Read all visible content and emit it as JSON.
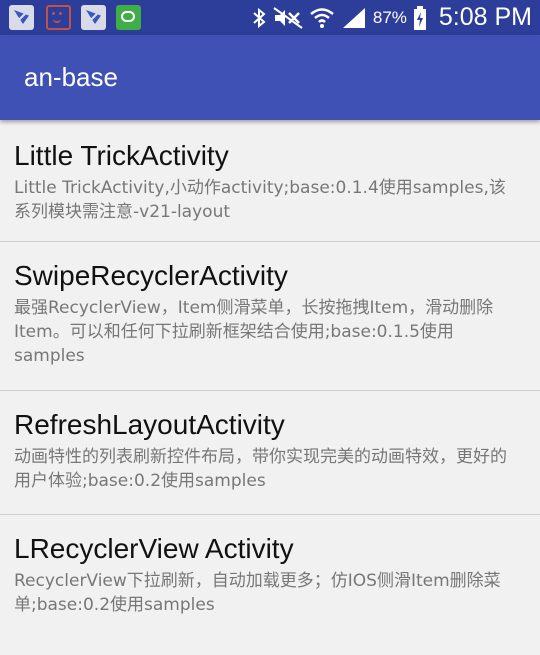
{
  "status_bar": {
    "notification_icons": [
      "app-bird-icon",
      "smiley-icon",
      "app-bird-icon",
      "chat-app-icon"
    ],
    "system_icons": [
      "bluetooth-icon",
      "mute-icon",
      "wifi-icon",
      "signal-icon",
      "battery-charging-icon"
    ],
    "battery": "87%",
    "time": "5:08 PM",
    "background_color": "#2c3e9a"
  },
  "app_bar": {
    "title": "an-base",
    "background_color": "#3f51b5"
  },
  "list": {
    "items": [
      {
        "title": "Little TrickActivity",
        "description": "Little TrickActivity,小动作activity;base:0.1.4使用samples,该系列模块需注意-v21-layout"
      },
      {
        "title": "SwipeRecyclerActivity",
        "description": "最强RecyclerView，Item侧滑菜单，长按拖拽Item，滑动删除Item。可以和任何下拉刷新框架结合使用;base:0.1.5使用samples"
      },
      {
        "title": "RefreshLayoutActivity",
        "description": "动画特性的列表刷新控件布局，带你实现完美的动画特效，更好的用户体验;base:0.2使用samples"
      },
      {
        "title": "LRecyclerView Activity",
        "description": "RecyclerView下拉刷新，自动加载更多；仿IOS侧滑Item删除菜单;base:0.2使用samples"
      }
    ]
  }
}
